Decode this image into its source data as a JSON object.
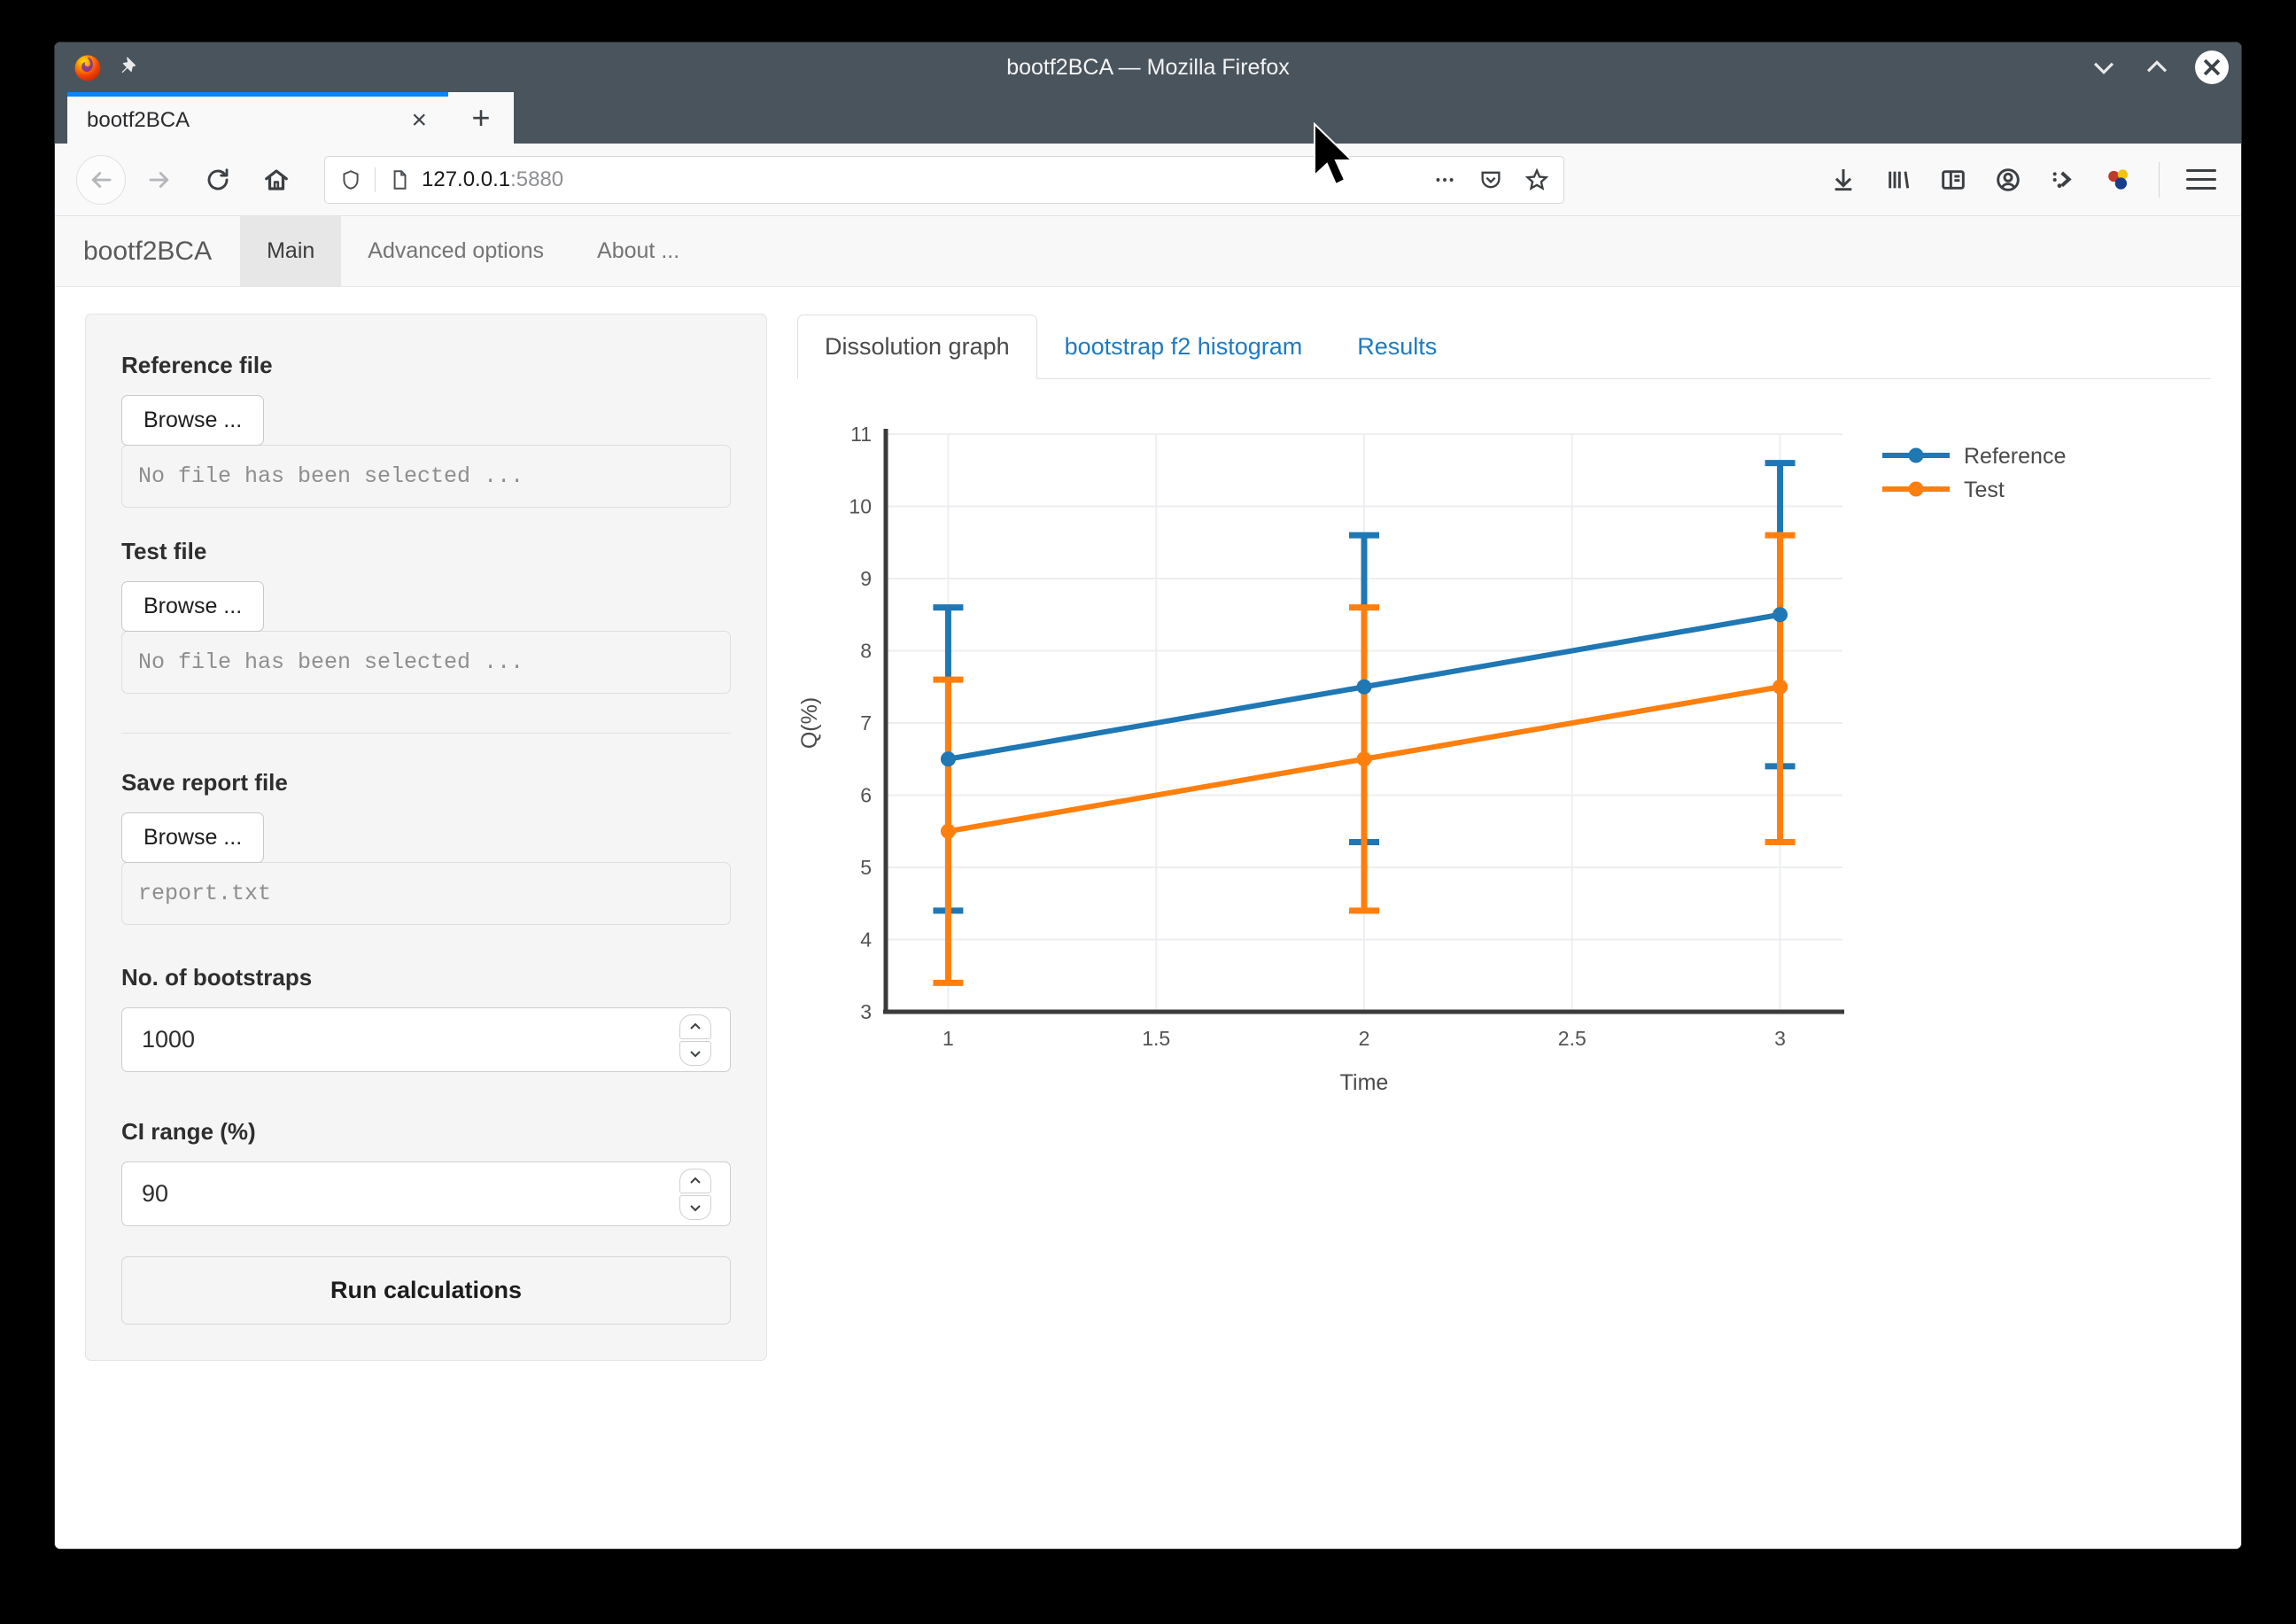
{
  "window": {
    "title": "bootf2BCA — Mozilla Firefox",
    "controls": {
      "minimize": "minimize",
      "maximize": "maximize",
      "close": "close"
    }
  },
  "browser": {
    "tab": {
      "title": "bootf2BCA",
      "close_label": "×"
    },
    "new_tab_label": "+",
    "url": {
      "host": "127.0.0.1",
      "port": ":5880"
    },
    "nav_icons": [
      "back-icon",
      "forward-icon",
      "reload-icon",
      "home-icon"
    ],
    "toolbar_icons": [
      "downloads-icon",
      "library-icon",
      "sidebar-icon",
      "account-icon",
      "devtools-icon",
      "containers-icon",
      "menu-icon"
    ],
    "urlbar_icons": [
      "shield-icon",
      "page-icon",
      "page-actions-icon",
      "pocket-icon",
      "bookmark-star-icon"
    ]
  },
  "app": {
    "brand": "bootf2BCA",
    "nav": [
      {
        "label": "Main",
        "active": true
      },
      {
        "label": "Advanced options",
        "active": false
      },
      {
        "label": "About ...",
        "active": false
      }
    ]
  },
  "sidebar": {
    "reference": {
      "label": "Reference file",
      "browse_label": "Browse ...",
      "value": "No file has been selected ..."
    },
    "test": {
      "label": "Test file",
      "browse_label": "Browse ...",
      "value": "No file has been selected ..."
    },
    "report": {
      "label": "Save report file",
      "browse_label": "Browse ...",
      "value": "report.txt"
    },
    "bootstraps": {
      "label": "No. of bootstraps",
      "value": "1000"
    },
    "ci_range": {
      "label": "CI range (%)",
      "value": "90"
    },
    "run_button": "Run calculations"
  },
  "content_tabs": [
    {
      "label": "Dissolution graph",
      "active": true
    },
    {
      "label": "bootstrap f2 histogram",
      "active": false
    },
    {
      "label": "Results",
      "active": false
    }
  ],
  "chart_data": {
    "type": "line",
    "title": "",
    "xlabel": "Time",
    "ylabel": "Q(%)",
    "x": [
      1,
      2,
      3
    ],
    "xlim": [
      0.85,
      3.15
    ],
    "ylim": [
      3,
      11
    ],
    "xticks": [
      "1",
      "1.5",
      "2",
      "2.5",
      "3"
    ],
    "xtickvals": [
      1,
      1.5,
      2,
      2.5,
      3
    ],
    "yticks": [
      "3",
      "4",
      "5",
      "6",
      "7",
      "8",
      "9",
      "10",
      "11"
    ],
    "ytickvals": [
      3,
      4,
      5,
      6,
      7,
      8,
      9,
      10,
      11
    ],
    "grid": true,
    "legend_position": "upper right",
    "series": [
      {
        "name": "Reference",
        "color": "#1f77b4",
        "values": [
          6.5,
          7.5,
          8.5
        ],
        "err_upper": [
          8.6,
          9.6,
          10.6
        ],
        "err_lower": [
          4.4,
          5.35,
          6.4
        ]
      },
      {
        "name": "Test",
        "color": "#ff7f0e",
        "values": [
          5.5,
          6.5,
          7.5
        ],
        "err_upper": [
          7.6,
          8.6,
          9.6
        ],
        "err_lower": [
          3.4,
          4.4,
          5.35
        ]
      }
    ]
  },
  "colors": {
    "reference": "#1f77b4",
    "test": "#ff7f0e",
    "titlebar": "#4a545c",
    "tab_accent": "#0a84ff",
    "link": "#1d7bc4"
  }
}
